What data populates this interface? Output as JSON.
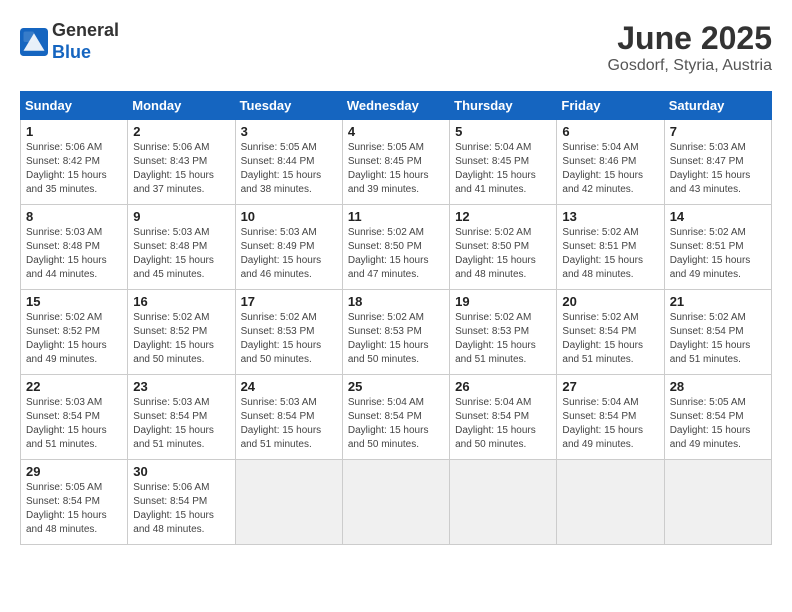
{
  "logo": {
    "general": "General",
    "blue": "Blue"
  },
  "title": "June 2025",
  "subtitle": "Gosdorf, Styria, Austria",
  "days_of_week": [
    "Sunday",
    "Monday",
    "Tuesday",
    "Wednesday",
    "Thursday",
    "Friday",
    "Saturday"
  ],
  "weeks": [
    [
      {
        "day": "1",
        "detail": "Sunrise: 5:06 AM\nSunset: 8:42 PM\nDaylight: 15 hours\nand 35 minutes."
      },
      {
        "day": "2",
        "detail": "Sunrise: 5:06 AM\nSunset: 8:43 PM\nDaylight: 15 hours\nand 37 minutes."
      },
      {
        "day": "3",
        "detail": "Sunrise: 5:05 AM\nSunset: 8:44 PM\nDaylight: 15 hours\nand 38 minutes."
      },
      {
        "day": "4",
        "detail": "Sunrise: 5:05 AM\nSunset: 8:45 PM\nDaylight: 15 hours\nand 39 minutes."
      },
      {
        "day": "5",
        "detail": "Sunrise: 5:04 AM\nSunset: 8:45 PM\nDaylight: 15 hours\nand 41 minutes."
      },
      {
        "day": "6",
        "detail": "Sunrise: 5:04 AM\nSunset: 8:46 PM\nDaylight: 15 hours\nand 42 minutes."
      },
      {
        "day": "7",
        "detail": "Sunrise: 5:03 AM\nSunset: 8:47 PM\nDaylight: 15 hours\nand 43 minutes."
      }
    ],
    [
      {
        "day": "8",
        "detail": "Sunrise: 5:03 AM\nSunset: 8:48 PM\nDaylight: 15 hours\nand 44 minutes."
      },
      {
        "day": "9",
        "detail": "Sunrise: 5:03 AM\nSunset: 8:48 PM\nDaylight: 15 hours\nand 45 minutes."
      },
      {
        "day": "10",
        "detail": "Sunrise: 5:03 AM\nSunset: 8:49 PM\nDaylight: 15 hours\nand 46 minutes."
      },
      {
        "day": "11",
        "detail": "Sunrise: 5:02 AM\nSunset: 8:50 PM\nDaylight: 15 hours\nand 47 minutes."
      },
      {
        "day": "12",
        "detail": "Sunrise: 5:02 AM\nSunset: 8:50 PM\nDaylight: 15 hours\nand 48 minutes."
      },
      {
        "day": "13",
        "detail": "Sunrise: 5:02 AM\nSunset: 8:51 PM\nDaylight: 15 hours\nand 48 minutes."
      },
      {
        "day": "14",
        "detail": "Sunrise: 5:02 AM\nSunset: 8:51 PM\nDaylight: 15 hours\nand 49 minutes."
      }
    ],
    [
      {
        "day": "15",
        "detail": "Sunrise: 5:02 AM\nSunset: 8:52 PM\nDaylight: 15 hours\nand 49 minutes."
      },
      {
        "day": "16",
        "detail": "Sunrise: 5:02 AM\nSunset: 8:52 PM\nDaylight: 15 hours\nand 50 minutes."
      },
      {
        "day": "17",
        "detail": "Sunrise: 5:02 AM\nSunset: 8:53 PM\nDaylight: 15 hours\nand 50 minutes."
      },
      {
        "day": "18",
        "detail": "Sunrise: 5:02 AM\nSunset: 8:53 PM\nDaylight: 15 hours\nand 50 minutes."
      },
      {
        "day": "19",
        "detail": "Sunrise: 5:02 AM\nSunset: 8:53 PM\nDaylight: 15 hours\nand 51 minutes."
      },
      {
        "day": "20",
        "detail": "Sunrise: 5:02 AM\nSunset: 8:54 PM\nDaylight: 15 hours\nand 51 minutes."
      },
      {
        "day": "21",
        "detail": "Sunrise: 5:02 AM\nSunset: 8:54 PM\nDaylight: 15 hours\nand 51 minutes."
      }
    ],
    [
      {
        "day": "22",
        "detail": "Sunrise: 5:03 AM\nSunset: 8:54 PM\nDaylight: 15 hours\nand 51 minutes."
      },
      {
        "day": "23",
        "detail": "Sunrise: 5:03 AM\nSunset: 8:54 PM\nDaylight: 15 hours\nand 51 minutes."
      },
      {
        "day": "24",
        "detail": "Sunrise: 5:03 AM\nSunset: 8:54 PM\nDaylight: 15 hours\nand 51 minutes."
      },
      {
        "day": "25",
        "detail": "Sunrise: 5:04 AM\nSunset: 8:54 PM\nDaylight: 15 hours\nand 50 minutes."
      },
      {
        "day": "26",
        "detail": "Sunrise: 5:04 AM\nSunset: 8:54 PM\nDaylight: 15 hours\nand 50 minutes."
      },
      {
        "day": "27",
        "detail": "Sunrise: 5:04 AM\nSunset: 8:54 PM\nDaylight: 15 hours\nand 49 minutes."
      },
      {
        "day": "28",
        "detail": "Sunrise: 5:05 AM\nSunset: 8:54 PM\nDaylight: 15 hours\nand 49 minutes."
      }
    ],
    [
      {
        "day": "29",
        "detail": "Sunrise: 5:05 AM\nSunset: 8:54 PM\nDaylight: 15 hours\nand 48 minutes."
      },
      {
        "day": "30",
        "detail": "Sunrise: 5:06 AM\nSunset: 8:54 PM\nDaylight: 15 hours\nand 48 minutes."
      },
      {
        "day": "",
        "detail": ""
      },
      {
        "day": "",
        "detail": ""
      },
      {
        "day": "",
        "detail": ""
      },
      {
        "day": "",
        "detail": ""
      },
      {
        "day": "",
        "detail": ""
      }
    ]
  ]
}
